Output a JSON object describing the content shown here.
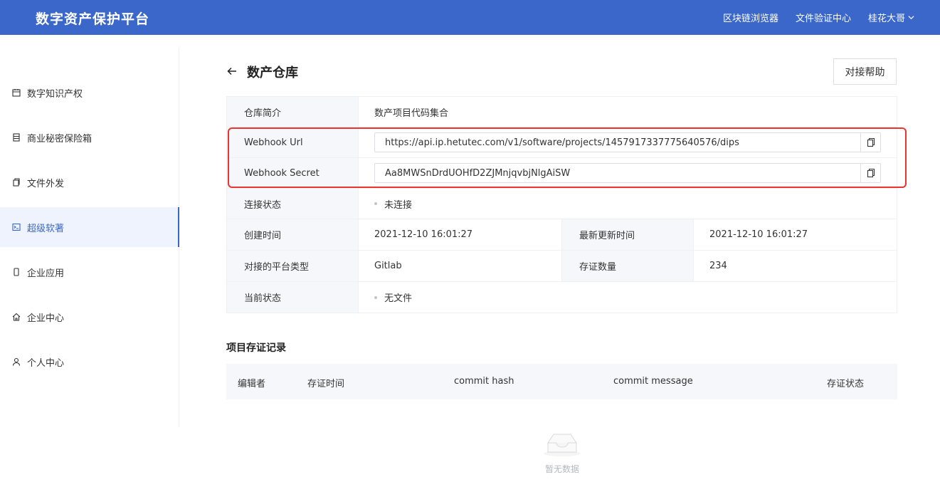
{
  "header": {
    "brand": "数字资产保护平台",
    "nav": [
      "区块链浏览器",
      "文件验证中心"
    ],
    "user": "桂花大哥"
  },
  "sidebar": {
    "items": [
      {
        "label": "数字知识产权",
        "icon": "calendar-icon"
      },
      {
        "label": "商业秘密保险箱",
        "icon": "list-icon"
      },
      {
        "label": "文件外发",
        "icon": "file-copy-icon"
      },
      {
        "label": "超级软著",
        "icon": "terminal-icon",
        "active": true
      },
      {
        "label": "企业应用",
        "icon": "phone-icon"
      },
      {
        "label": "企业中心",
        "icon": "home-icon"
      },
      {
        "label": "个人中心",
        "icon": "user-icon"
      }
    ]
  },
  "page": {
    "title": "数产仓库",
    "help_button": "对接帮助"
  },
  "info": {
    "repo_desc_label": "仓库简介",
    "repo_desc_value": "数产项目代码集合",
    "webhook_url_label": "Webhook Url",
    "webhook_url_value": "https://api.ip.hetutec.com/v1/software/projects/1457917337775640576/dips",
    "webhook_secret_label": "Webhook Secret",
    "webhook_secret_value": "Aa8MWSnDrdUOHfD2ZJMnjqvbjNlgAiSW",
    "conn_label": "连接状态",
    "conn_value": "未连接",
    "created_label": "创建时间",
    "created_value": "2021-12-10 16:01:27",
    "updated_label": "最新更新时间",
    "updated_value": "2021-12-10 16:01:27",
    "platform_label": "对接的平台类型",
    "platform_value": "Gitlab",
    "count_label": "存证数量",
    "count_value": "234",
    "status_label": "当前状态",
    "status_value": "无文件"
  },
  "records": {
    "title": "项目存证记录",
    "columns": [
      "编辑者",
      "存证时间",
      "commit hash",
      "commit message",
      "存证状态"
    ],
    "empty_text": "暂无数据"
  },
  "colors": {
    "header_bg": "#3a67c9",
    "highlight": "#e8352f"
  }
}
